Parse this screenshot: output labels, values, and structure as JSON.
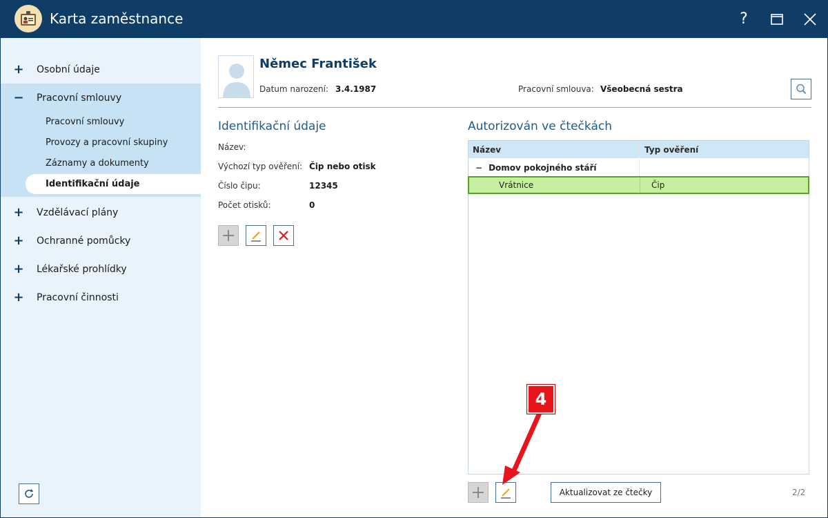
{
  "window": {
    "title": "Karta zaměstnance",
    "help": "?",
    "colors": {
      "titlebar": "#0f3d66",
      "accent": "#1f5a8c",
      "selected_row": "#c6efa0",
      "annotation": "#e8141b"
    }
  },
  "sidebar": {
    "items": [
      {
        "sign": "+",
        "label": "Osobní údaje"
      },
      {
        "sign": "−",
        "label": "Pracovní smlouvy"
      },
      {
        "sign": "+",
        "label": "Vzdělávací plány"
      },
      {
        "sign": "+",
        "label": "Ochranné pomůcky"
      },
      {
        "sign": "+",
        "label": "Lékařské prohlídky"
      },
      {
        "sign": "+",
        "label": "Pracovní činnosti"
      }
    ],
    "subitems": [
      {
        "label": "Pracovní smlouvy"
      },
      {
        "label": "Provozy a pracovní skupiny"
      },
      {
        "label": "Záznamy a dokumenty"
      },
      {
        "label": "Identifikační údaje"
      }
    ]
  },
  "header": {
    "name": "Němec František",
    "dob_label": "Datum narození:",
    "dob_value": "3.4.1987",
    "contract_label": "Pracovní smlouva:",
    "contract_value": "Všeobecná sestra"
  },
  "identification": {
    "title": "Identifikační údaje",
    "fields": [
      {
        "label": "Název:",
        "value": ""
      },
      {
        "label": "Výchozí typ ověření:",
        "value": "Čip nebo otisk"
      },
      {
        "label": "Číslo čipu:",
        "value": "12345"
      },
      {
        "label": "Počet otisků:",
        "value": "0"
      }
    ]
  },
  "readers": {
    "title": "Autorizován ve čtečkách",
    "columns": [
      "Název",
      "Typ ověření"
    ],
    "group": {
      "toggle": "−",
      "name": "Domov pokojného stáří"
    },
    "rows": [
      {
        "name": "Vrátnice",
        "type": "Čip"
      }
    ],
    "update_button": "Aktualizovat ze čtečky",
    "pager": "2/2"
  },
  "annotation": {
    "number": "4"
  }
}
